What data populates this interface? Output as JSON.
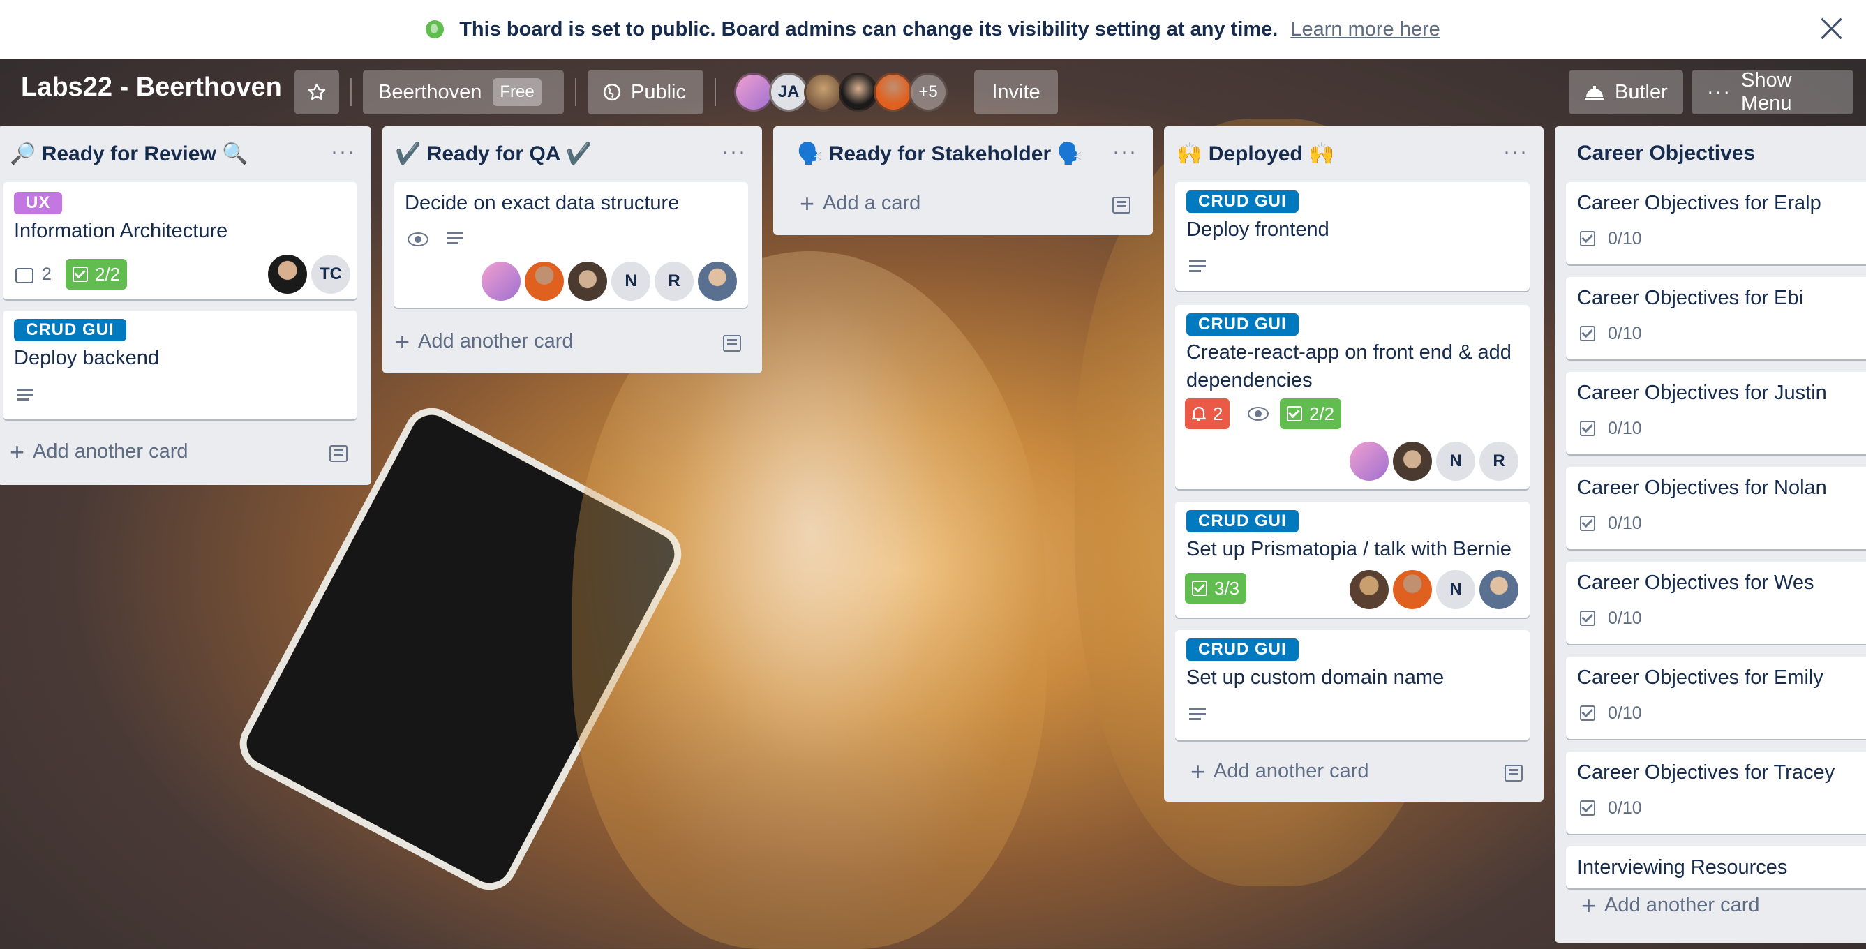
{
  "banner": {
    "message": "This board is set to public. Board admins can change its visibility setting at any time.",
    "link": "Learn more here"
  },
  "header": {
    "board_title": "Labs22 - Beerthoven",
    "team_name": "Beerthoven",
    "team_plan": "Free",
    "visibility": "Public",
    "member_initials": "JA",
    "more_members": "+5",
    "invite": "Invite",
    "butler": "Butler",
    "show_menu": "Show Menu"
  },
  "colors": {
    "label_ux": "#c377e0",
    "label_crud": "#0079bf",
    "green": "#61bd4f",
    "red": "#eb5a46",
    "list_bg": "#ebecf0"
  },
  "lists": [
    {
      "title": "🔎 Ready for Review 🔍",
      "cards": [
        {
          "label": "UX",
          "title": "Information Architecture",
          "comments": "2",
          "checklist": "2/2",
          "member_initials": "TC"
        },
        {
          "label": "CRUD GUI",
          "title": "Deploy backend"
        }
      ],
      "add": "Add another card"
    },
    {
      "title": "✔️ Ready for QA ✔️",
      "cards": [
        {
          "title": "Decide on exact data structure",
          "members": [
            "N",
            "R"
          ]
        }
      ],
      "add": "Add another card"
    },
    {
      "title": "🗣️ Ready for Stakeholder 🗣️",
      "cards": [],
      "add": "Add a card"
    },
    {
      "title": "🙌 Deployed 🙌",
      "cards": [
        {
          "label": "CRUD GUI",
          "title": "Deploy frontend"
        },
        {
          "label": "CRUD GUI",
          "title_line1": "Create-react-app on front end & add",
          "title_line2": "dependencies",
          "notifications": "2",
          "checklist": "2/2",
          "members": [
            "N",
            "R"
          ]
        },
        {
          "label": "CRUD GUI",
          "title": "Set up Prismatopia / talk with Bernie",
          "checklist": "3/3",
          "members": [
            "N"
          ]
        },
        {
          "label": "CRUD GUI",
          "title": "Set up custom domain name"
        }
      ],
      "add": "Add another card"
    },
    {
      "title": "Career Objectives",
      "cards": [
        {
          "title": "Career Objectives for Eralp",
          "checklist": "0/10"
        },
        {
          "title": "Career Objectives for Ebi",
          "checklist": "0/10"
        },
        {
          "title": "Career Objectives for Justin",
          "checklist": "0/10"
        },
        {
          "title": "Career Objectives for Nolan",
          "checklist": "0/10"
        },
        {
          "title": "Career Objectives for Wes",
          "checklist": "0/10"
        },
        {
          "title": "Career Objectives for Emily",
          "checklist": "0/10"
        },
        {
          "title": "Career Objectives for Tracey",
          "checklist": "0/10"
        },
        {
          "title": "Interviewing Resources"
        }
      ],
      "add": "Add another card"
    }
  ]
}
